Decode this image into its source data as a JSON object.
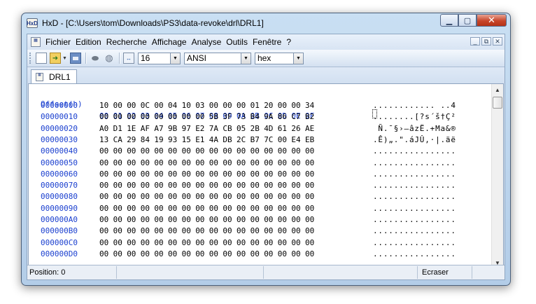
{
  "window": {
    "title": "HxD - [C:\\Users\\tom\\Downloads\\PS3\\data-revoke\\drl\\DRL1]",
    "app_icon_text": "HxD"
  },
  "menu": [
    "Fichier",
    "Edition",
    "Recherche",
    "Affichage",
    "Analyse",
    "Outils",
    "Fenêtre",
    "?"
  ],
  "toolbar": {
    "bytes_per_row": "16",
    "charset": "ANSI",
    "offset_base": "hex"
  },
  "tab": {
    "label": "DRL1"
  },
  "hex_view": {
    "header_offset": "Offset(h)",
    "columns": [
      "00",
      "01",
      "02",
      "03",
      "04",
      "05",
      "06",
      "07",
      "08",
      "09",
      "0A",
      "0B",
      "0C",
      "0D",
      "0E",
      "0F"
    ],
    "rows": [
      {
        "offset": "00000000",
        "bytes": [
          "10",
          "00",
          "00",
          "0C",
          "00",
          "04",
          "10",
          "03",
          "00",
          "00",
          "00",
          "01",
          "20",
          "00",
          "00",
          "34"
        ],
        "text": "............ ..4"
      },
      {
        "offset": "00000010",
        "bytes": [
          "00",
          "00",
          "00",
          "00",
          "00",
          "00",
          "00",
          "00",
          "5B",
          "3F",
          "73",
          "B4",
          "9A",
          "86",
          "C7",
          "B2"
        ],
        "text": "........[?s´š†Ç²"
      },
      {
        "offset": "00000020",
        "bytes": [
          "A0",
          "D1",
          "1E",
          "AF",
          "A7",
          "9B",
          "97",
          "E2",
          "7A",
          "CB",
          "05",
          "2B",
          "4D",
          "61",
          "26",
          "AE"
        ],
        "text": " Ñ.¯§›—âzË.+Ma&®"
      },
      {
        "offset": "00000030",
        "bytes": [
          "13",
          "CA",
          "29",
          "84",
          "19",
          "93",
          "15",
          "E1",
          "4A",
          "DB",
          "2C",
          "B7",
          "7C",
          "00",
          "E4",
          "EB"
        ],
        "text": ".Ê)„.\".áJÛ,·|.äë"
      },
      {
        "offset": "00000040",
        "bytes": [
          "00",
          "00",
          "00",
          "00",
          "00",
          "00",
          "00",
          "00",
          "00",
          "00",
          "00",
          "00",
          "00",
          "00",
          "00",
          "00"
        ],
        "text": "................"
      },
      {
        "offset": "00000050",
        "bytes": [
          "00",
          "00",
          "00",
          "00",
          "00",
          "00",
          "00",
          "00",
          "00",
          "00",
          "00",
          "00",
          "00",
          "00",
          "00",
          "00"
        ],
        "text": "................"
      },
      {
        "offset": "00000060",
        "bytes": [
          "00",
          "00",
          "00",
          "00",
          "00",
          "00",
          "00",
          "00",
          "00",
          "00",
          "00",
          "00",
          "00",
          "00",
          "00",
          "00"
        ],
        "text": "................"
      },
      {
        "offset": "00000070",
        "bytes": [
          "00",
          "00",
          "00",
          "00",
          "00",
          "00",
          "00",
          "00",
          "00",
          "00",
          "00",
          "00",
          "00",
          "00",
          "00",
          "00"
        ],
        "text": "................"
      },
      {
        "offset": "00000080",
        "bytes": [
          "00",
          "00",
          "00",
          "00",
          "00",
          "00",
          "00",
          "00",
          "00",
          "00",
          "00",
          "00",
          "00",
          "00",
          "00",
          "00"
        ],
        "text": "................"
      },
      {
        "offset": "00000090",
        "bytes": [
          "00",
          "00",
          "00",
          "00",
          "00",
          "00",
          "00",
          "00",
          "00",
          "00",
          "00",
          "00",
          "00",
          "00",
          "00",
          "00"
        ],
        "text": "................"
      },
      {
        "offset": "000000A0",
        "bytes": [
          "00",
          "00",
          "00",
          "00",
          "00",
          "00",
          "00",
          "00",
          "00",
          "00",
          "00",
          "00",
          "00",
          "00",
          "00",
          "00"
        ],
        "text": "................"
      },
      {
        "offset": "000000B0",
        "bytes": [
          "00",
          "00",
          "00",
          "00",
          "00",
          "00",
          "00",
          "00",
          "00",
          "00",
          "00",
          "00",
          "00",
          "00",
          "00",
          "00"
        ],
        "text": "................"
      },
      {
        "offset": "000000C0",
        "bytes": [
          "00",
          "00",
          "00",
          "00",
          "00",
          "00",
          "00",
          "00",
          "00",
          "00",
          "00",
          "00",
          "00",
          "00",
          "00",
          "00"
        ],
        "text": "................"
      },
      {
        "offset": "000000D0",
        "bytes": [
          "00",
          "00",
          "00",
          "00",
          "00",
          "00",
          "00",
          "00",
          "00",
          "00",
          "00",
          "00",
          "00",
          "00",
          "00",
          "00"
        ],
        "text": "................"
      }
    ]
  },
  "status": {
    "position": "Position: 0",
    "mode": "Ecraser"
  }
}
